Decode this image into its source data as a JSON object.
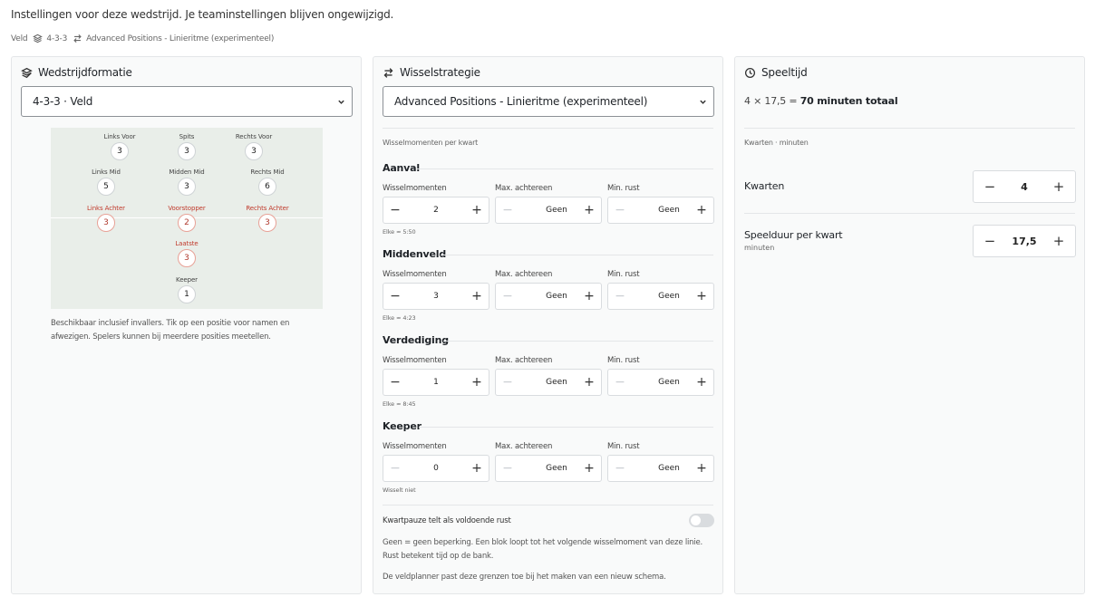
{
  "header": {
    "subtitle": "Instellingen voor deze wedstrijd. Je teaminstellingen blijven ongewijzigd.",
    "breadcrumb": {
      "field": "Veld",
      "formation": "4-3-3",
      "strategy": "Advanced Positions - Linieritme (experimenteel)"
    }
  },
  "formation_card": {
    "title": "Wedstrijdformatie",
    "selected": "4-3-3 · Veld",
    "positions": [
      {
        "label": "Links Voor",
        "count": "3",
        "flagged": false
      },
      {
        "label": "Spits",
        "count": "3",
        "flagged": false
      },
      {
        "label": "Rechts Voor",
        "count": "3",
        "flagged": false
      },
      {
        "label": "Links Mid",
        "count": "5",
        "flagged": false
      },
      {
        "label": "Midden Mid",
        "count": "3",
        "flagged": false
      },
      {
        "label": "Rechts Mid",
        "count": "6",
        "flagged": false
      },
      {
        "label": "Links Achter",
        "count": "3",
        "flagged": true
      },
      {
        "label": "Voorstopper",
        "count": "2",
        "flagged": true
      },
      {
        "label": "Rechts Achter",
        "count": "3",
        "flagged": true
      },
      {
        "label": "Laatste",
        "count": "3",
        "flagged": true
      },
      {
        "label": "Keeper",
        "count": "1",
        "flagged": false
      }
    ],
    "note": "Beschikbaar inclusief invallers. Tik op een positie voor namen en afwezigen. Spelers kunnen bij meerdere posities meetellen."
  },
  "strategy_card": {
    "title": "Wisselstrategie",
    "selected": "Advanced Positions - Linieritme (experimenteel)",
    "section_label": "Wisselmomenten per kwart",
    "col_labels": {
      "moments": "Wisselmomenten",
      "max": "Max. achtereen",
      "rest": "Min. rust"
    },
    "lines": [
      {
        "name": "Aanval",
        "moments": "2",
        "max": "Geen",
        "rest": "Geen",
        "hint": "Elke ≈ 5:50"
      },
      {
        "name": "Middenveld",
        "moments": "3",
        "max": "Geen",
        "rest": "Geen",
        "hint": "Elke ≈ 4:23"
      },
      {
        "name": "Verdediging",
        "moments": "1",
        "max": "Geen",
        "rest": "Geen",
        "hint": "Elke ≈ 8:45"
      },
      {
        "name": "Keeper",
        "moments": "0",
        "max": "Geen",
        "rest": "Geen",
        "hint": "Wisselt niet"
      }
    ],
    "toggle_label": "Kwartpauze telt als voldoende rust",
    "toggle_on": false,
    "note1": "Geen = geen beperking. Een blok loopt tot het volgende wisselmoment van deze linie. Rust betekent tijd op de bank.",
    "note2": "De veldplanner past deze grenzen toe bij het maken van een nieuw schema."
  },
  "time_card": {
    "title": "Speeltijd",
    "total_prefix": "4 × 17,5 = ",
    "total_bold": "70 minuten totaal",
    "section_label": "Kwarten · minuten",
    "quarters_label": "Kwarten",
    "quarters_value": "4",
    "duration_label": "Speelduur per kwart",
    "duration_sub": "minuten",
    "duration_value": "17,5"
  },
  "glyphs": {
    "minus": "−",
    "plus": "+"
  }
}
